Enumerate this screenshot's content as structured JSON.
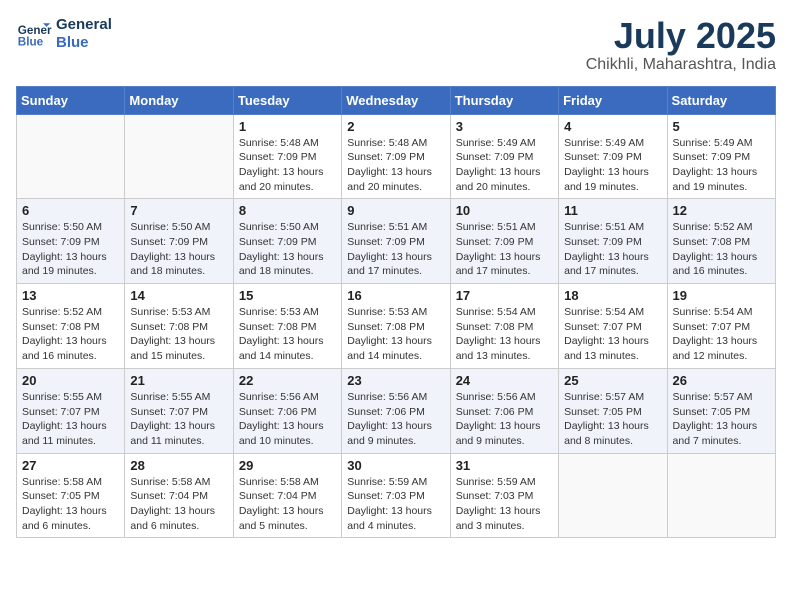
{
  "header": {
    "logo_line1": "General",
    "logo_line2": "Blue",
    "month": "July 2025",
    "location": "Chikhli, Maharashtra, India"
  },
  "days_of_week": [
    "Sunday",
    "Monday",
    "Tuesday",
    "Wednesday",
    "Thursday",
    "Friday",
    "Saturday"
  ],
  "weeks": [
    [
      {
        "num": "",
        "info": ""
      },
      {
        "num": "",
        "info": ""
      },
      {
        "num": "1",
        "info": "Sunrise: 5:48 AM\nSunset: 7:09 PM\nDaylight: 13 hours and 20 minutes."
      },
      {
        "num": "2",
        "info": "Sunrise: 5:48 AM\nSunset: 7:09 PM\nDaylight: 13 hours and 20 minutes."
      },
      {
        "num": "3",
        "info": "Sunrise: 5:49 AM\nSunset: 7:09 PM\nDaylight: 13 hours and 20 minutes."
      },
      {
        "num": "4",
        "info": "Sunrise: 5:49 AM\nSunset: 7:09 PM\nDaylight: 13 hours and 19 minutes."
      },
      {
        "num": "5",
        "info": "Sunrise: 5:49 AM\nSunset: 7:09 PM\nDaylight: 13 hours and 19 minutes."
      }
    ],
    [
      {
        "num": "6",
        "info": "Sunrise: 5:50 AM\nSunset: 7:09 PM\nDaylight: 13 hours and 19 minutes."
      },
      {
        "num": "7",
        "info": "Sunrise: 5:50 AM\nSunset: 7:09 PM\nDaylight: 13 hours and 18 minutes."
      },
      {
        "num": "8",
        "info": "Sunrise: 5:50 AM\nSunset: 7:09 PM\nDaylight: 13 hours and 18 minutes."
      },
      {
        "num": "9",
        "info": "Sunrise: 5:51 AM\nSunset: 7:09 PM\nDaylight: 13 hours and 17 minutes."
      },
      {
        "num": "10",
        "info": "Sunrise: 5:51 AM\nSunset: 7:09 PM\nDaylight: 13 hours and 17 minutes."
      },
      {
        "num": "11",
        "info": "Sunrise: 5:51 AM\nSunset: 7:09 PM\nDaylight: 13 hours and 17 minutes."
      },
      {
        "num": "12",
        "info": "Sunrise: 5:52 AM\nSunset: 7:08 PM\nDaylight: 13 hours and 16 minutes."
      }
    ],
    [
      {
        "num": "13",
        "info": "Sunrise: 5:52 AM\nSunset: 7:08 PM\nDaylight: 13 hours and 16 minutes."
      },
      {
        "num": "14",
        "info": "Sunrise: 5:53 AM\nSunset: 7:08 PM\nDaylight: 13 hours and 15 minutes."
      },
      {
        "num": "15",
        "info": "Sunrise: 5:53 AM\nSunset: 7:08 PM\nDaylight: 13 hours and 14 minutes."
      },
      {
        "num": "16",
        "info": "Sunrise: 5:53 AM\nSunset: 7:08 PM\nDaylight: 13 hours and 14 minutes."
      },
      {
        "num": "17",
        "info": "Sunrise: 5:54 AM\nSunset: 7:08 PM\nDaylight: 13 hours and 13 minutes."
      },
      {
        "num": "18",
        "info": "Sunrise: 5:54 AM\nSunset: 7:07 PM\nDaylight: 13 hours and 13 minutes."
      },
      {
        "num": "19",
        "info": "Sunrise: 5:54 AM\nSunset: 7:07 PM\nDaylight: 13 hours and 12 minutes."
      }
    ],
    [
      {
        "num": "20",
        "info": "Sunrise: 5:55 AM\nSunset: 7:07 PM\nDaylight: 13 hours and 11 minutes."
      },
      {
        "num": "21",
        "info": "Sunrise: 5:55 AM\nSunset: 7:07 PM\nDaylight: 13 hours and 11 minutes."
      },
      {
        "num": "22",
        "info": "Sunrise: 5:56 AM\nSunset: 7:06 PM\nDaylight: 13 hours and 10 minutes."
      },
      {
        "num": "23",
        "info": "Sunrise: 5:56 AM\nSunset: 7:06 PM\nDaylight: 13 hours and 9 minutes."
      },
      {
        "num": "24",
        "info": "Sunrise: 5:56 AM\nSunset: 7:06 PM\nDaylight: 13 hours and 9 minutes."
      },
      {
        "num": "25",
        "info": "Sunrise: 5:57 AM\nSunset: 7:05 PM\nDaylight: 13 hours and 8 minutes."
      },
      {
        "num": "26",
        "info": "Sunrise: 5:57 AM\nSunset: 7:05 PM\nDaylight: 13 hours and 7 minutes."
      }
    ],
    [
      {
        "num": "27",
        "info": "Sunrise: 5:58 AM\nSunset: 7:05 PM\nDaylight: 13 hours and 6 minutes."
      },
      {
        "num": "28",
        "info": "Sunrise: 5:58 AM\nSunset: 7:04 PM\nDaylight: 13 hours and 6 minutes."
      },
      {
        "num": "29",
        "info": "Sunrise: 5:58 AM\nSunset: 7:04 PM\nDaylight: 13 hours and 5 minutes."
      },
      {
        "num": "30",
        "info": "Sunrise: 5:59 AM\nSunset: 7:03 PM\nDaylight: 13 hours and 4 minutes."
      },
      {
        "num": "31",
        "info": "Sunrise: 5:59 AM\nSunset: 7:03 PM\nDaylight: 13 hours and 3 minutes."
      },
      {
        "num": "",
        "info": ""
      },
      {
        "num": "",
        "info": ""
      }
    ]
  ]
}
